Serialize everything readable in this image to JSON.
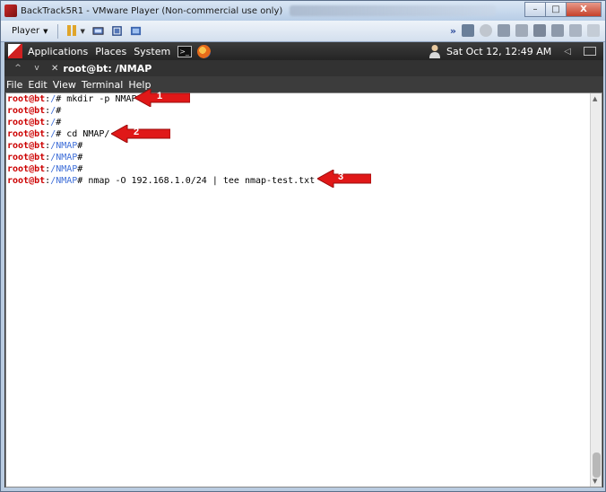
{
  "window": {
    "title": "BackTrack5R1 - VMware Player (Non-commercial use only)",
    "controls": {
      "minimize": "–",
      "maximize": "□",
      "close": "X"
    }
  },
  "toolbar": {
    "player_label": "Player",
    "icons": [
      "pause-icon",
      "send-keys-icon",
      "fullscreen-icon",
      "unity-icon"
    ],
    "device_icons": [
      "network-icon",
      "cdrom-icon",
      "floppy-icon",
      "hdd-icon",
      "usb-icon",
      "sound-icon",
      "printer-icon",
      "message-icon"
    ]
  },
  "gnome_panel": {
    "menus": [
      "Applications",
      "Places",
      "System"
    ],
    "clock": "Sat Oct 12, 12:49 AM"
  },
  "terminal": {
    "title": "root@bt: /NMAP",
    "menus": [
      "File",
      "Edit",
      "View",
      "Terminal",
      "Help"
    ],
    "lines": [
      {
        "user": "root@bt",
        "path": "/",
        "mark": "#",
        "cmd": " mkdir -p NMAP"
      },
      {
        "user": "root@bt",
        "path": "/",
        "mark": "#",
        "cmd": ""
      },
      {
        "user": "root@bt",
        "path": "/",
        "mark": "#",
        "cmd": ""
      },
      {
        "user": "root@bt",
        "path": "/",
        "mark": "#",
        "cmd": " cd NMAP/"
      },
      {
        "user": "root@bt",
        "path": "/NMAP",
        "mark": "#",
        "cmd": ""
      },
      {
        "user": "root@bt",
        "path": "/NMAP",
        "mark": "#",
        "cmd": ""
      },
      {
        "user": "root@bt",
        "path": "/NMAP",
        "mark": "#",
        "cmd": ""
      },
      {
        "user": "root@bt",
        "path": "/NMAP",
        "mark": "#",
        "cmd": " nmap -O 192.168.1.0/24 | tee nmap-test.txt"
      }
    ]
  },
  "callouts": [
    "1",
    "2",
    "3"
  ],
  "colors": {
    "prompt_user": "#cc0000",
    "prompt_path": "#3f6fd8",
    "callout": "#e01818"
  }
}
